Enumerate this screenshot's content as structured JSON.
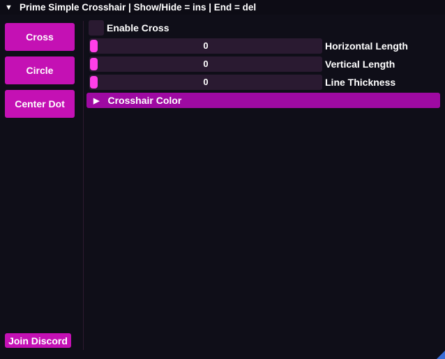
{
  "window": {
    "title": "Prime Simple Crosshair | Show/Hide = ins | End = del",
    "title_arrow": "▼"
  },
  "sidebar": {
    "items": [
      {
        "label": "Cross"
      },
      {
        "label": "Circle"
      },
      {
        "label": "Center Dot"
      }
    ],
    "join_label": "Join Discord"
  },
  "main": {
    "enable_cross": {
      "label": "Enable Cross",
      "checked": false
    },
    "sliders": [
      {
        "label": "Horizontal Length",
        "value": "0"
      },
      {
        "label": "Vertical Length",
        "value": "0"
      },
      {
        "label": "Line Thickness",
        "value": "0"
      }
    ],
    "crosshair_color": {
      "label": "Crosshair Color",
      "arrow": "▶"
    }
  },
  "colors": {
    "background": "#0f0e18",
    "button": "#c411b4",
    "frame": "#2a1a31",
    "slider_grab": "#ff3fe8",
    "header": "#9e0aa2",
    "resize_grip": "#3a6fd8"
  }
}
